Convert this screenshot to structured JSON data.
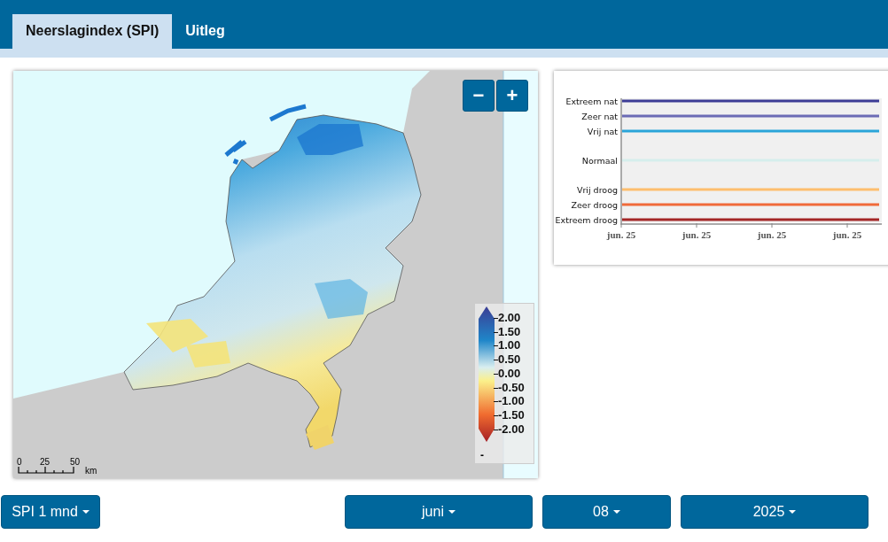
{
  "tabs": [
    {
      "label": "Neerslagindex (SPI)",
      "selected": true
    },
    {
      "label": "Uitleg",
      "selected": false
    }
  ],
  "map": {
    "zoom_buttons": [
      "−",
      "+"
    ],
    "legend": {
      "labels": [
        "2.00",
        "1.50",
        "1.00",
        "0.50",
        "0.00",
        "-0.50",
        "-1.00",
        "-1.50",
        "-2.00"
      ],
      "footer": "-"
    },
    "scale_bar": {
      "ticks": [
        "0",
        "25",
        "50"
      ],
      "unit": "km"
    }
  },
  "chart": {
    "levels": [
      {
        "label": "Extreem nat",
        "color": "#3c3c96"
      },
      {
        "label": "Zeer nat",
        "color": "#6b6bb5"
      },
      {
        "label": "Vrij nat",
        "color": "#2aa5d9"
      },
      {
        "label": "Normaal",
        "color": "#d5eeec"
      },
      {
        "label": "Vrij droog",
        "color": "#fdbe6e"
      },
      {
        "label": "Zeer droog",
        "color": "#f06a3a"
      },
      {
        "label": "Extreem droog",
        "color": "#a32626"
      }
    ],
    "x_labels": [
      "jun. 25",
      "jun. 25",
      "jun. 25",
      "jun. 25"
    ]
  },
  "controls": [
    {
      "label": "SPI 1 mnd"
    },
    {
      "label": "juni"
    },
    {
      "label": "08"
    },
    {
      "label": "2025"
    }
  ]
}
